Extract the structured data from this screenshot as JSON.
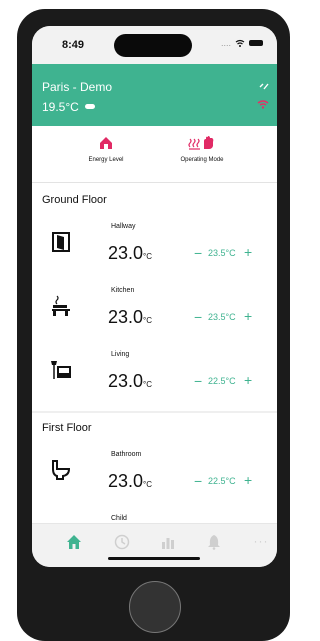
{
  "status": {
    "time": "8:49",
    "dots": "....",
    "wifi": "wifi-icon",
    "battery": "battery-icon"
  },
  "header": {
    "location": "Paris - Demo",
    "temperature": "19.5°C",
    "weather_icon": "cloud-icon",
    "mode_icon": "lightning-icon",
    "wifi_icon": "wifi-icon",
    "wifi_color": "#e33166",
    "bg_color": "#3fb390"
  },
  "modes": [
    {
      "label": "Energy Level",
      "icon": "house-energy-icon"
    },
    {
      "label": "Operating Mode",
      "icon": "heat-hand-icon"
    }
  ],
  "sections": [
    {
      "title": "Ground Floor",
      "rooms": [
        {
          "name": "Hallway",
          "temp": "23.0",
          "unit": "°C",
          "setpoint": "23.5°C",
          "icon": "door-icon"
        },
        {
          "name": "Kitchen",
          "temp": "23.0",
          "unit": "°C",
          "setpoint": "23.5°C",
          "icon": "stove-icon"
        },
        {
          "name": "Living",
          "temp": "23.0",
          "unit": "°C",
          "setpoint": "22.5°C",
          "icon": "armchair-lamp-icon"
        }
      ]
    },
    {
      "title": "First Floor",
      "rooms": [
        {
          "name": "Bathroom",
          "temp": "23.0",
          "unit": "°C",
          "setpoint": "22.5°C",
          "icon": "toilet-icon"
        },
        {
          "name": "Child",
          "icon": "rocking-horse-icon"
        }
      ]
    }
  ],
  "controls": {
    "minus": "−",
    "plus": "+"
  },
  "tabs": [
    {
      "name": "home",
      "icon": "home-icon",
      "active": true
    },
    {
      "name": "schedule",
      "icon": "clock-icon",
      "active": false
    },
    {
      "name": "stats",
      "icon": "bar-chart-icon",
      "active": false
    },
    {
      "name": "alerts",
      "icon": "bell-icon",
      "active": false
    },
    {
      "name": "more",
      "icon": "more-icon",
      "active": false,
      "label": "···"
    }
  ],
  "accent_color": "#3fb390",
  "brand_pink": "#e12a65"
}
